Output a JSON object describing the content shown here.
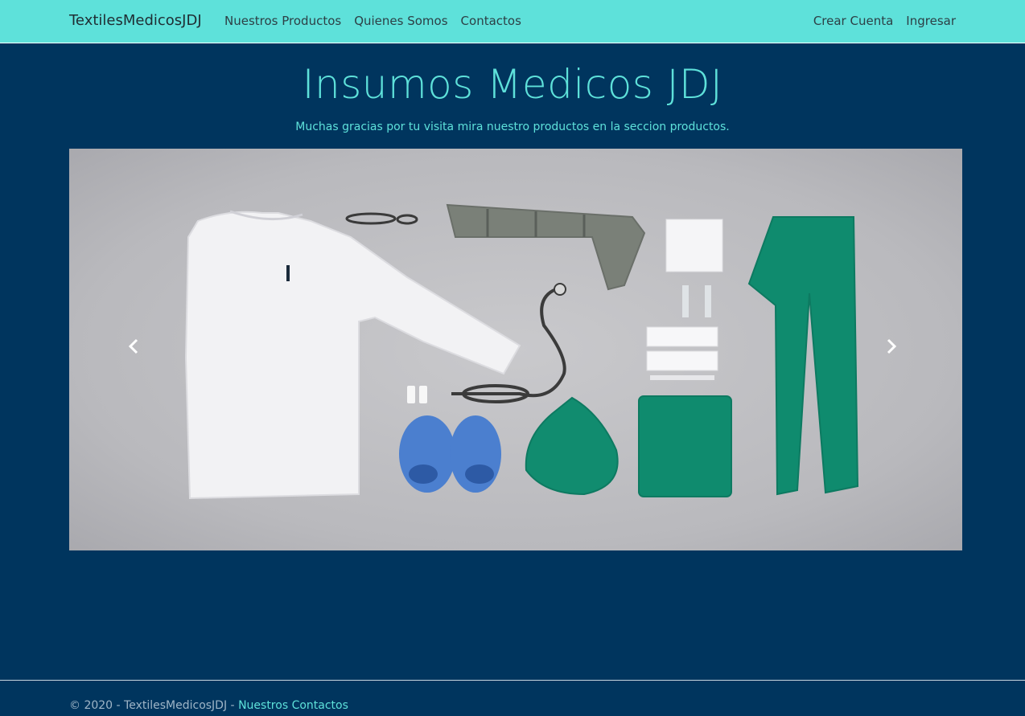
{
  "navbar": {
    "brand": "TextilesMedicosJDJ",
    "left_links": [
      "Nuestros Productos",
      "Quienes Somos",
      "Contactos"
    ],
    "right_links": [
      "Crear Cuenta",
      "Ingresar"
    ]
  },
  "hero": {
    "title": "Insumos Medicos JDJ",
    "subtitle": "Muchas gracias por tu visita mira nuestro productos en la seccion productos."
  },
  "carousel": {
    "prev_icon": "chevron-left-icon",
    "next_icon": "chevron-right-icon"
  },
  "footer": {
    "copyright": "© 2020 - TextilesMedicosJDJ - ",
    "link": "Nuestros Contactos"
  },
  "colors": {
    "navbar": "#5ee1da",
    "background": "#00355e",
    "accent": "#5ee1da"
  }
}
